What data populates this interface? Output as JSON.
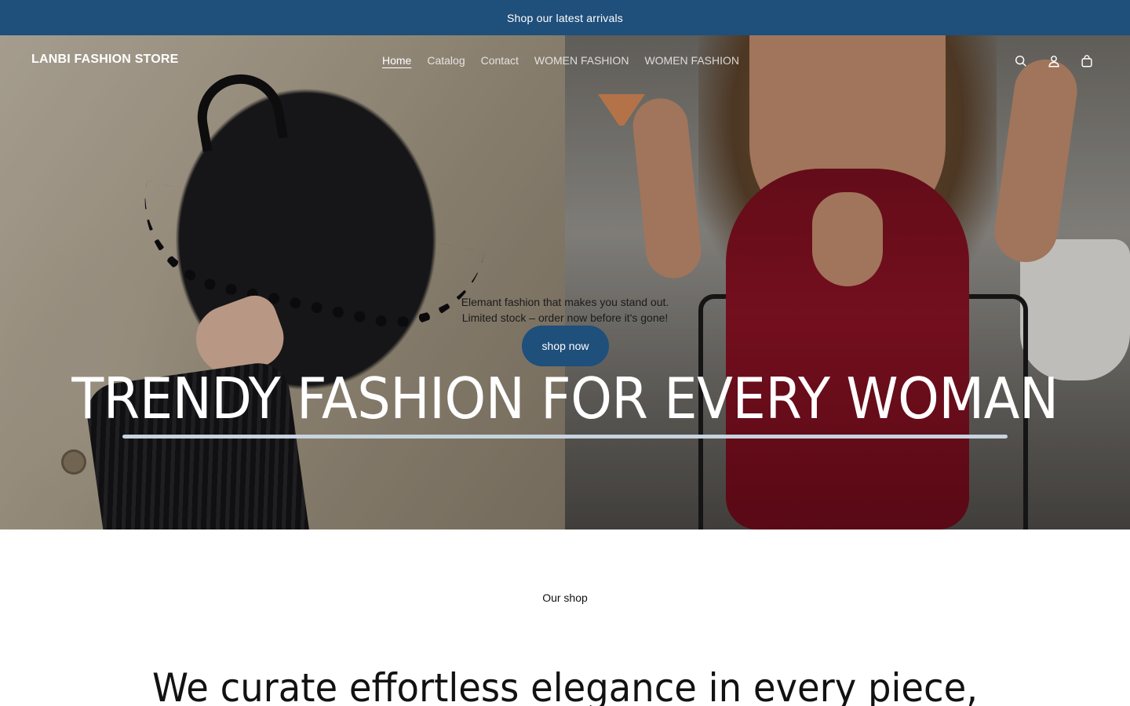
{
  "announcement": {
    "text": "Shop our latest arrivals"
  },
  "header": {
    "logo": "LANBI FASHION STORE",
    "nav": [
      {
        "label": "Home",
        "active": true
      },
      {
        "label": "Catalog",
        "active": false
      },
      {
        "label": "Contact",
        "active": false
      },
      {
        "label": "WOMEN FASHION",
        "active": false
      },
      {
        "label": "WOMEN FASHION",
        "active": false
      }
    ],
    "icons": [
      "search-icon",
      "account-icon",
      "cart-icon"
    ]
  },
  "hero": {
    "text_line1": "Elemant fashion that makes you stand out.",
    "text_line2": "Limited stock – order now before it's gone!",
    "button_label": "shop now",
    "heading": "TRENDY FASHION FOR EVERY WOMAN"
  },
  "section": {
    "label": "Our shop",
    "heading": "We curate effortless elegance in every piece,"
  },
  "colors": {
    "brand": "#1f4f7b",
    "text": "#121212",
    "underline": "#c7d3de"
  }
}
